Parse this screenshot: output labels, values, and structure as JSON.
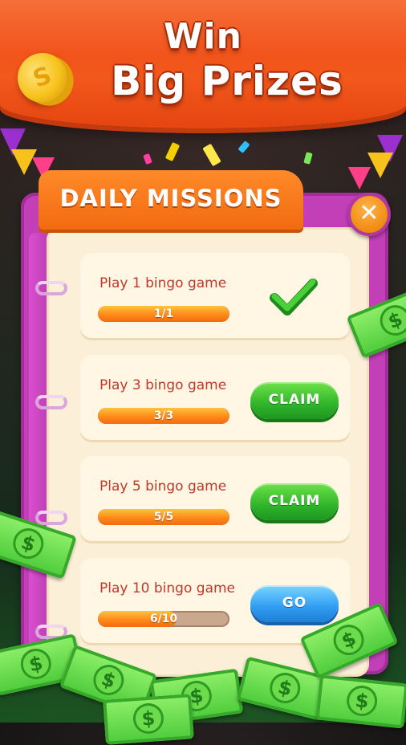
{
  "header": {
    "title_line1": "Win",
    "title_line2": "Big Prizes"
  },
  "panel": {
    "title": "DAILY MISSIONS",
    "close_icon": "close-icon"
  },
  "missions": [
    {
      "label": "Play 1 bingo game",
      "progress_text": "1/1",
      "progress": 1.0,
      "action": "completed",
      "action_icon": "checkmark-icon"
    },
    {
      "label": "Play 3 bingo game",
      "progress_text": "3/3",
      "progress": 1.0,
      "action": "CLAIM"
    },
    {
      "label": "Play 5 bingo game",
      "progress_text": "5/5",
      "progress": 1.0,
      "action": "CLAIM"
    },
    {
      "label": "Play 10 bingo game",
      "progress_text": "6/10",
      "progress": 0.6,
      "action": "GO"
    }
  ],
  "colors": {
    "header_orange": "#f3581c",
    "tab_orange": "#f26a10",
    "book_magenta": "#c23fb8",
    "claim_green": "#2fb52a",
    "go_blue": "#2f9cf2",
    "mission_text": "#c0392b"
  }
}
